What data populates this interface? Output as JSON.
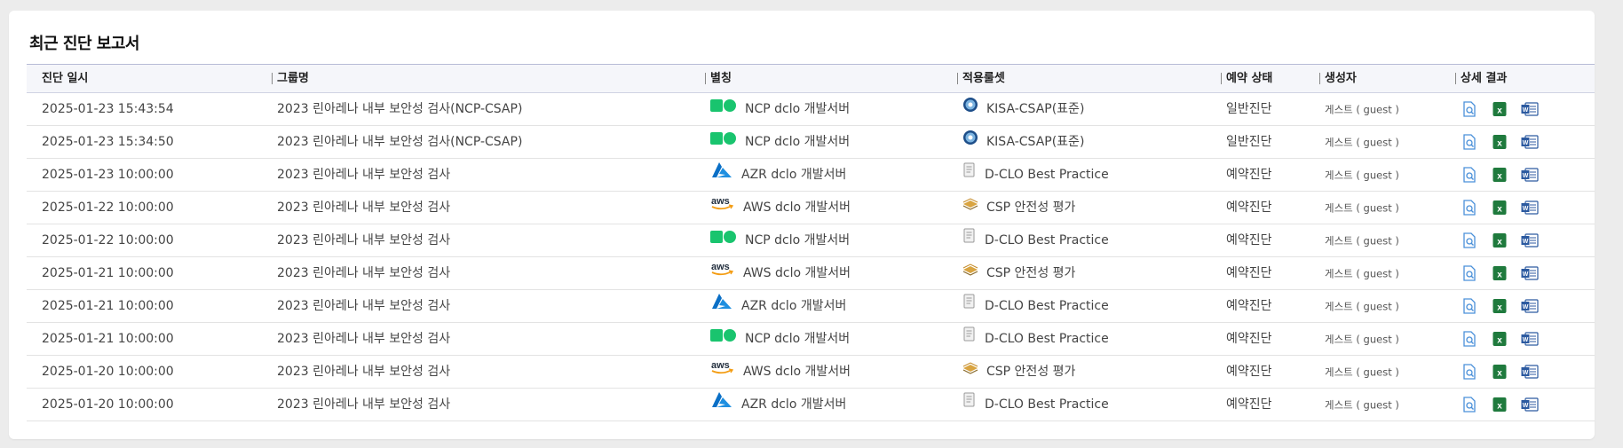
{
  "panel": {
    "title": "최근 진단 보고서"
  },
  "columns": [
    "진단 일시",
    "그룹명",
    "별칭",
    "적용룰셋",
    "예약 상태",
    "생성자",
    "상세 결과"
  ],
  "rows": [
    {
      "date": "2025-01-23 15:43:54",
      "group": "2023 린아레나 내부 보안성 검사(NCP-CSAP)",
      "provider": "ncp",
      "alias": "NCP dclo 개발서버",
      "ruleset_icon": "kisa",
      "ruleset": "KISA-CSAP(표준)",
      "status": "일반진단",
      "creator": "게스트 ( guest )"
    },
    {
      "date": "2025-01-23 15:34:50",
      "group": "2023 린아레나 내부 보안성 검사(NCP-CSAP)",
      "provider": "ncp",
      "alias": "NCP dclo 개발서버",
      "ruleset_icon": "kisa",
      "ruleset": "KISA-CSAP(표준)",
      "status": "일반진단",
      "creator": "게스트 ( guest )"
    },
    {
      "date": "2025-01-23 10:00:00",
      "group": "2023 린아레나 내부 보안성 검사",
      "provider": "azure",
      "alias": "AZR dclo 개발서버",
      "ruleset_icon": "doc",
      "ruleset": "D-CLO Best Practice",
      "status": "예약진단",
      "creator": "게스트 ( guest )"
    },
    {
      "date": "2025-01-22 10:00:00",
      "group": "2023 린아레나 내부 보안성 검사",
      "provider": "aws",
      "alias": "AWS dclo 개발서버",
      "ruleset_icon": "layers",
      "ruleset": "CSP 안전성 평가",
      "status": "예약진단",
      "creator": "게스트 ( guest )"
    },
    {
      "date": "2025-01-22 10:00:00",
      "group": "2023 린아레나 내부 보안성 검사",
      "provider": "ncp",
      "alias": "NCP dclo 개발서버",
      "ruleset_icon": "doc",
      "ruleset": "D-CLO Best Practice",
      "status": "예약진단",
      "creator": "게스트 ( guest )"
    },
    {
      "date": "2025-01-21 10:00:00",
      "group": "2023 린아레나 내부 보안성 검사",
      "provider": "aws",
      "alias": "AWS dclo 개발서버",
      "ruleset_icon": "layers",
      "ruleset": "CSP 안전성 평가",
      "status": "예약진단",
      "creator": "게스트 ( guest )"
    },
    {
      "date": "2025-01-21 10:00:00",
      "group": "2023 린아레나 내부 보안성 검사",
      "provider": "azure",
      "alias": "AZR dclo 개발서버",
      "ruleset_icon": "doc",
      "ruleset": "D-CLO Best Practice",
      "status": "예약진단",
      "creator": "게스트 ( guest )"
    },
    {
      "date": "2025-01-21 10:00:00",
      "group": "2023 린아레나 내부 보안성 검사",
      "provider": "ncp",
      "alias": "NCP dclo 개발서버",
      "ruleset_icon": "doc",
      "ruleset": "D-CLO Best Practice",
      "status": "예약진단",
      "creator": "게스트 ( guest )"
    },
    {
      "date": "2025-01-20 10:00:00",
      "group": "2023 린아레나 내부 보안성 검사",
      "provider": "aws",
      "alias": "AWS dclo 개발서버",
      "ruleset_icon": "layers",
      "ruleset": "CSP 안전성 평가",
      "status": "예약진단",
      "creator": "게스트 ( guest )"
    },
    {
      "date": "2025-01-20 10:00:00",
      "group": "2023 린아레나 내부 보안성 검사",
      "provider": "azure",
      "alias": "AZR dclo 개발서버",
      "ruleset_icon": "doc",
      "ruleset": "D-CLO Best Practice",
      "status": "예약진단",
      "creator": "게스트 ( guest )"
    }
  ],
  "row_actions": [
    "view-report-icon",
    "excel-icon",
    "word-icon"
  ],
  "colors": {
    "ncp_green": "#19c46e",
    "azure_blue": "#0a6fc6",
    "aws_orange": "#f39c12",
    "excel_green": "#1f7a3d",
    "word_blue": "#2c5aa0",
    "view_blue": "#4a90d9",
    "header_border": "#b7bbd6"
  }
}
